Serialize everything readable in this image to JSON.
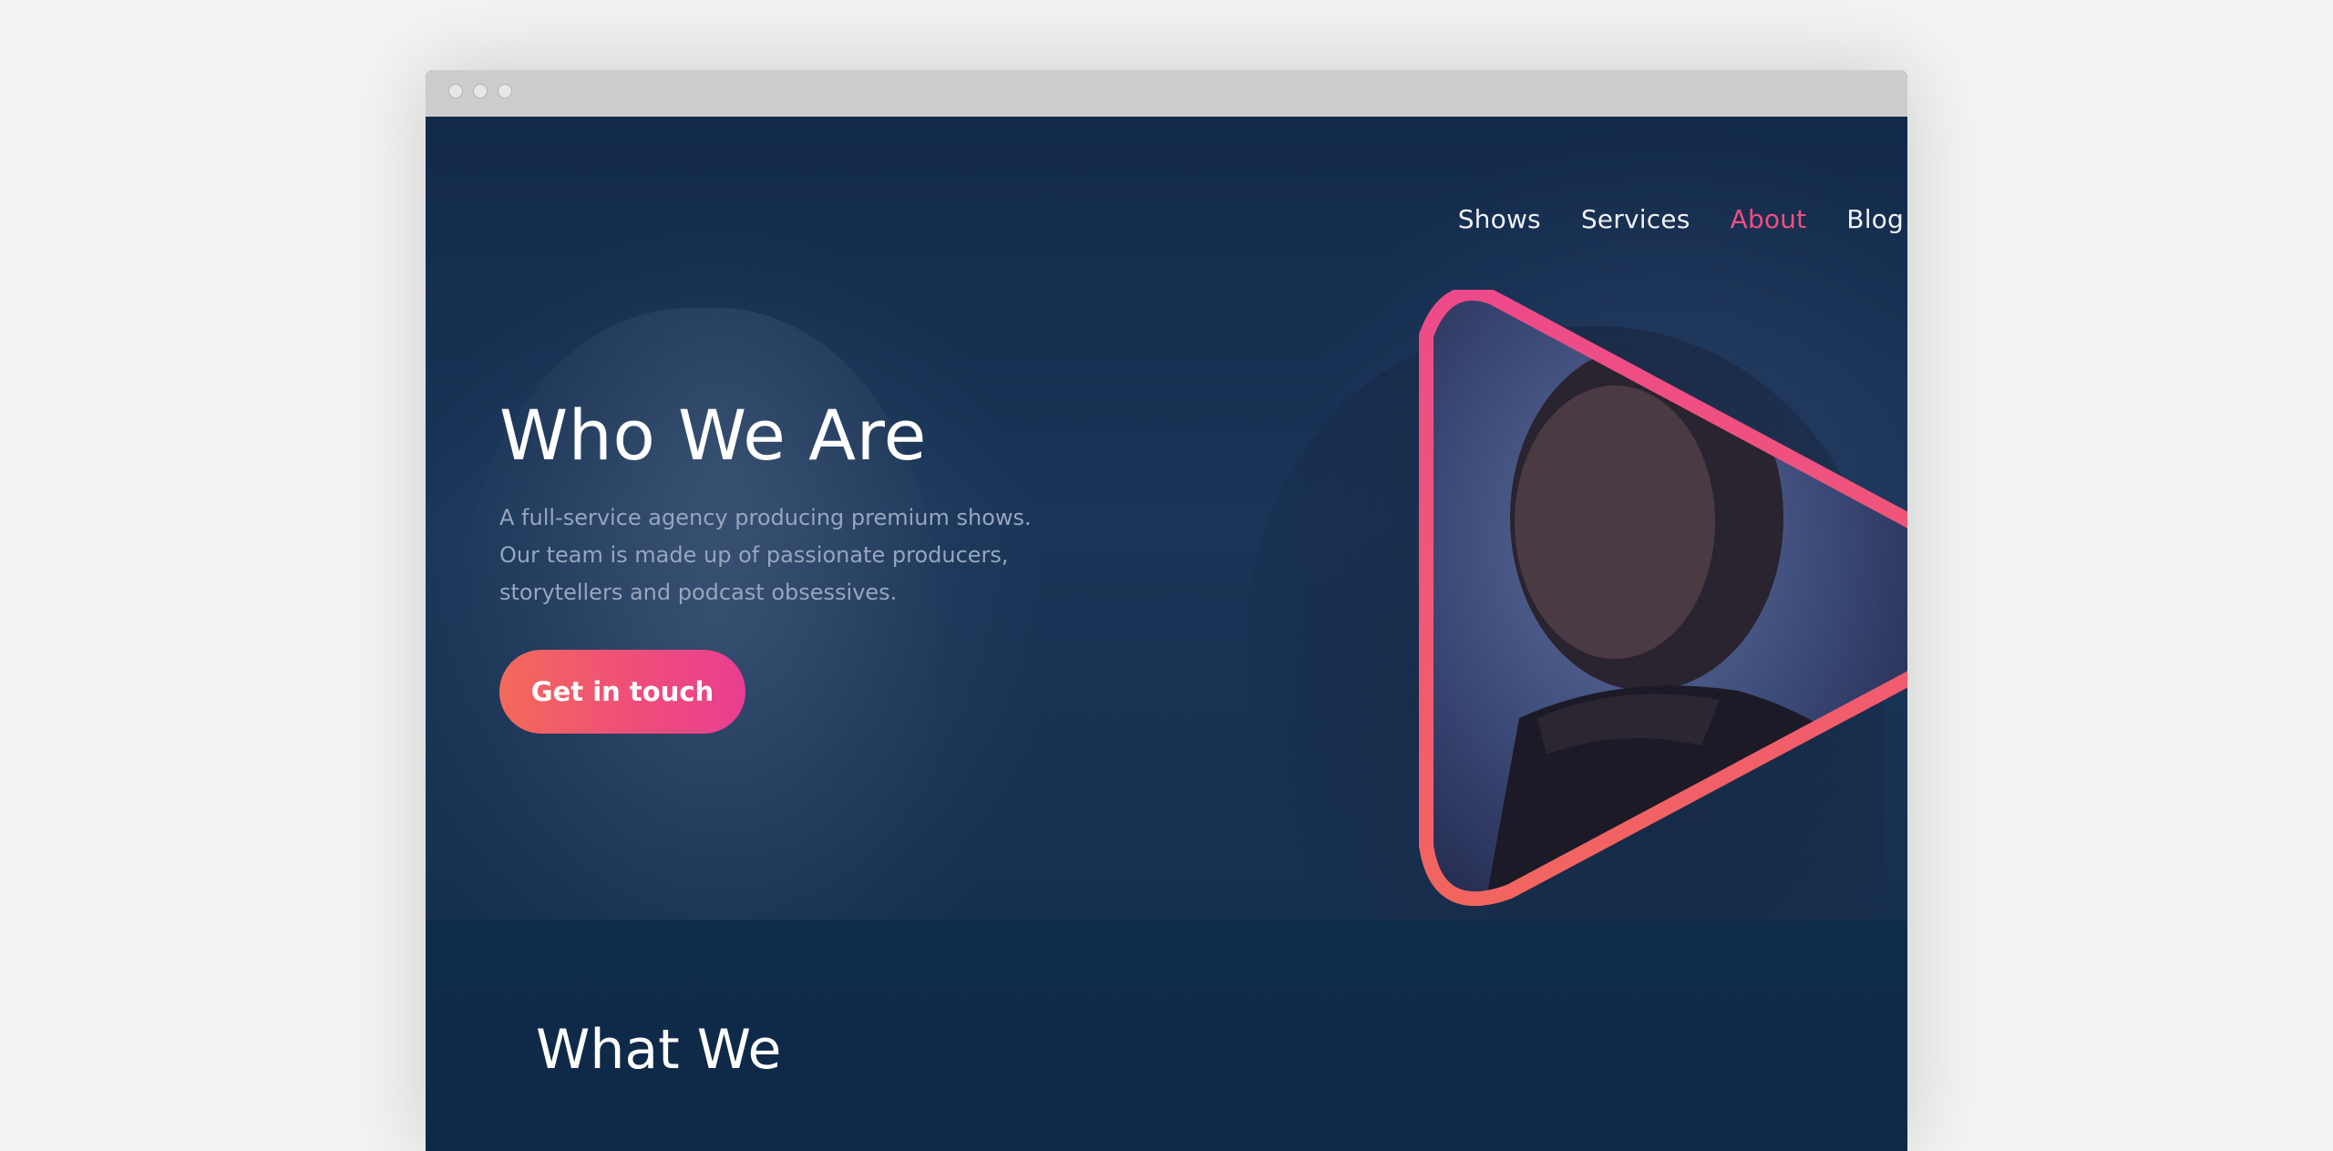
{
  "window": {
    "controls": [
      "close",
      "minimize",
      "maximize"
    ]
  },
  "nav": {
    "items": [
      {
        "label": "Shows",
        "active": false
      },
      {
        "label": "Services",
        "active": false
      },
      {
        "label": "About",
        "active": true
      },
      {
        "label": "Blog",
        "active": false
      }
    ]
  },
  "hero": {
    "title": "Who We Are",
    "description": "A full-service agency producing premium shows. Our team is made up of passionate producers, storytellers and podcast obsessives.",
    "cta_label": "Get in touch",
    "image": "play-triangle-portrait"
  },
  "section2": {
    "title": "What We"
  },
  "colors": {
    "background": "#0e2a48",
    "accent": "#ef4f82",
    "accent_start": "#f36a5a",
    "accent_end": "#e93e91",
    "text_muted": "#96a6be",
    "page_bg": "#f3f3f3"
  }
}
